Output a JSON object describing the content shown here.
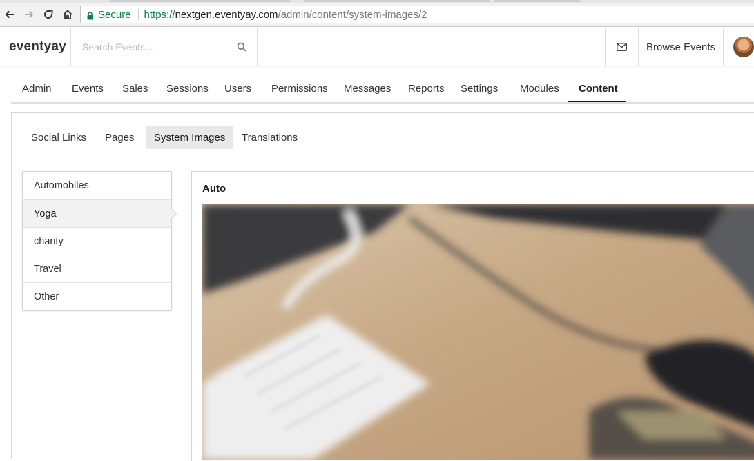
{
  "browser": {
    "secure_label": "Secure",
    "url_scheme": "https://",
    "url_host": "nextgen.eventyay.com",
    "url_path": "/admin/content/system-images/2"
  },
  "header": {
    "brand": "eventyay",
    "search_placeholder": "Search Events...",
    "browse_events_label": "Browse Events"
  },
  "main_tabs": [
    {
      "label": "Admin"
    },
    {
      "label": "Events"
    },
    {
      "label": "Sales"
    },
    {
      "label": "Sessions"
    },
    {
      "label": "Users"
    },
    {
      "label": "Permissions"
    },
    {
      "label": "Messages"
    },
    {
      "label": "Reports"
    },
    {
      "label": "Settings"
    },
    {
      "label": "Modules"
    },
    {
      "label": "Content",
      "active": true
    }
  ],
  "sub_tabs": [
    {
      "label": "Social Links"
    },
    {
      "label": "Pages"
    },
    {
      "label": "System Images",
      "active": true
    },
    {
      "label": "Translations"
    }
  ],
  "categories": [
    {
      "label": "Automobiles"
    },
    {
      "label": "Yoga",
      "active": true
    },
    {
      "label": "charity"
    },
    {
      "label": "Travel"
    },
    {
      "label": "Other"
    }
  ],
  "image_panel": {
    "title": "Auto"
  },
  "icons": {
    "back": "back-arrow-icon",
    "forward": "forward-arrow-icon",
    "reload": "reload-icon",
    "home": "home-icon",
    "lock": "lock-icon",
    "search": "search-icon",
    "mail": "envelope-icon"
  },
  "colors": {
    "secure_green": "#0b8043",
    "active_tab_bg": "#e8e8e8",
    "active_underline": "#1b1c1d"
  }
}
